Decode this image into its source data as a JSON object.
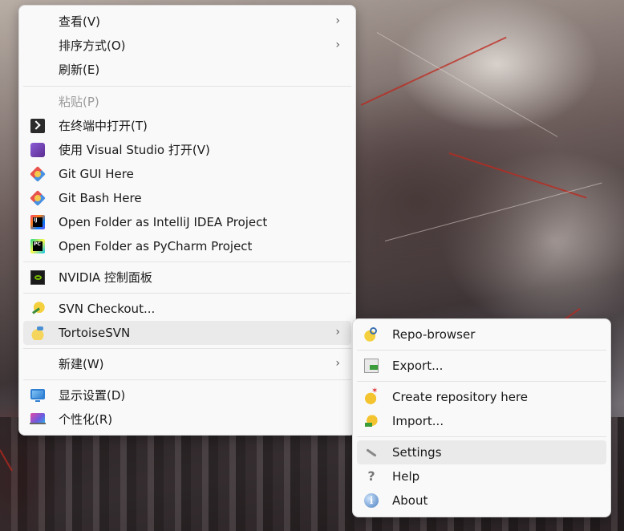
{
  "main_menu": {
    "items": [
      {
        "label": "查看(V)",
        "has_submenu": true
      },
      {
        "label": "排序方式(O)",
        "has_submenu": true
      },
      {
        "label": "刷新(E)"
      },
      {
        "label": "粘贴(P)",
        "disabled": true
      },
      {
        "label": "在终端中打开(T)",
        "icon": "terminal-icon"
      },
      {
        "label": "使用 Visual Studio 打开(V)",
        "icon": "visual-studio-icon"
      },
      {
        "label": "Git GUI Here",
        "icon": "git-icon"
      },
      {
        "label": "Git Bash Here",
        "icon": "git-icon"
      },
      {
        "label": "Open Folder as IntelliJ IDEA Project",
        "icon": "intellij-icon",
        "icon_text": "IJ"
      },
      {
        "label": "Open Folder as PyCharm Project",
        "icon": "pycharm-icon",
        "icon_text": "PC"
      },
      {
        "label": "NVIDIA 控制面板",
        "icon": "nvidia-icon"
      },
      {
        "label": "SVN Checkout...",
        "icon": "svn-checkout-icon"
      },
      {
        "label": "TortoiseSVN",
        "icon": "tortoisesvn-icon",
        "has_submenu": true,
        "highlighted": true
      },
      {
        "label": "新建(W)",
        "has_submenu": true
      },
      {
        "label": "显示设置(D)",
        "icon": "display-settings-icon"
      },
      {
        "label": "个性化(R)",
        "icon": "personalize-icon"
      }
    ],
    "submenu_arrow": "›"
  },
  "tortoisesvn_submenu": {
    "items": [
      {
        "label": "Repo-browser",
        "icon": "repo-browser-icon"
      },
      {
        "label": "Export...",
        "icon": "export-icon"
      },
      {
        "label": "Create repository here",
        "icon": "create-repository-icon"
      },
      {
        "label": "Import...",
        "icon": "import-icon"
      },
      {
        "label": "Settings",
        "icon": "wrench-icon",
        "highlighted": true
      },
      {
        "label": "Help",
        "icon": "help-icon",
        "icon_text": "?"
      },
      {
        "label": "About",
        "icon": "info-icon",
        "icon_text": "i"
      }
    ]
  },
  "colors": {
    "menu_background": "#f9f9f9",
    "highlight": "#eaeaea",
    "disabled_text": "#9a9a9a"
  }
}
